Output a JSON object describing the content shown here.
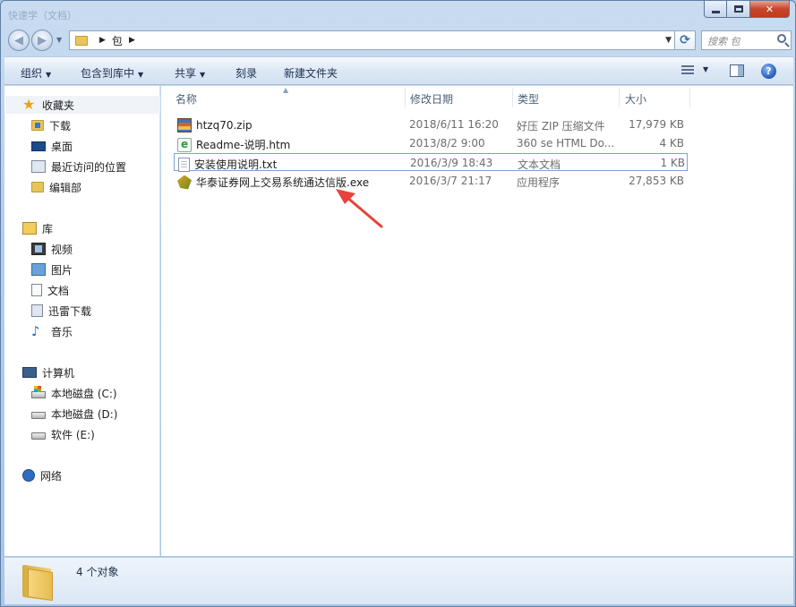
{
  "window": {
    "title": "快速学（文档）",
    "buttons": {
      "minimize": "minimize",
      "maximize": "maximize",
      "close": "✕"
    }
  },
  "address": {
    "path": [
      "包"
    ],
    "search_placeholder": "搜索 包"
  },
  "toolbar": {
    "organize": "组织",
    "include_in_library": "包含到库中",
    "share": "共享",
    "burn": "刻录",
    "new_folder": "新建文件夹"
  },
  "sidebar": {
    "favorites": {
      "label": "收藏夹",
      "items": [
        {
          "label": "下载",
          "icon": "download-folder-icon"
        },
        {
          "label": "桌面",
          "icon": "desktop-icon"
        },
        {
          "label": "最近访问的位置",
          "icon": "recent-places-icon"
        },
        {
          "label": "编辑部",
          "icon": "folder-icon"
        }
      ]
    },
    "libraries": {
      "label": "库",
      "items": [
        {
          "label": "视频",
          "icon": "video-icon"
        },
        {
          "label": "图片",
          "icon": "pictures-icon"
        },
        {
          "label": "文档",
          "icon": "documents-icon"
        },
        {
          "label": "迅雷下载",
          "icon": "thunder-download-icon"
        },
        {
          "label": "音乐",
          "icon": "music-icon"
        }
      ]
    },
    "computer": {
      "label": "计算机",
      "items": [
        {
          "label": "本地磁盘 (C:)",
          "icon": "system-drive-icon"
        },
        {
          "label": "本地磁盘 (D:)",
          "icon": "drive-icon"
        },
        {
          "label": "软件 (E:)",
          "icon": "drive-icon"
        }
      ]
    },
    "network": {
      "label": "网络"
    }
  },
  "columns": {
    "name": "名称",
    "modified": "修改日期",
    "type": "类型",
    "size": "大小"
  },
  "files": [
    {
      "name": "htzq70.zip",
      "modified": "2018/6/11 16:20",
      "type": "好压 ZIP 压缩文件",
      "size": "17,979 KB",
      "icon": "zip-icon"
    },
    {
      "name": "Readme-说明.htm",
      "modified": "2013/8/2 9:00",
      "type": "360 se HTML Do...",
      "size": "4 KB",
      "icon": "html-file-icon"
    },
    {
      "name": "安装使用说明.txt",
      "modified": "2016/3/9 18:43",
      "type": "文本文档",
      "size": "1 KB",
      "icon": "text-file-icon"
    },
    {
      "name": "华泰证券网上交易系统通达信版.exe",
      "modified": "2016/3/7 21:17",
      "type": "应用程序",
      "size": "27,853 KB",
      "icon": "exe-icon"
    }
  ],
  "status": {
    "count": "4 个对象"
  },
  "colors": {
    "annotation_arrow": "#e8433a",
    "selection_border": "#7da2ce"
  }
}
